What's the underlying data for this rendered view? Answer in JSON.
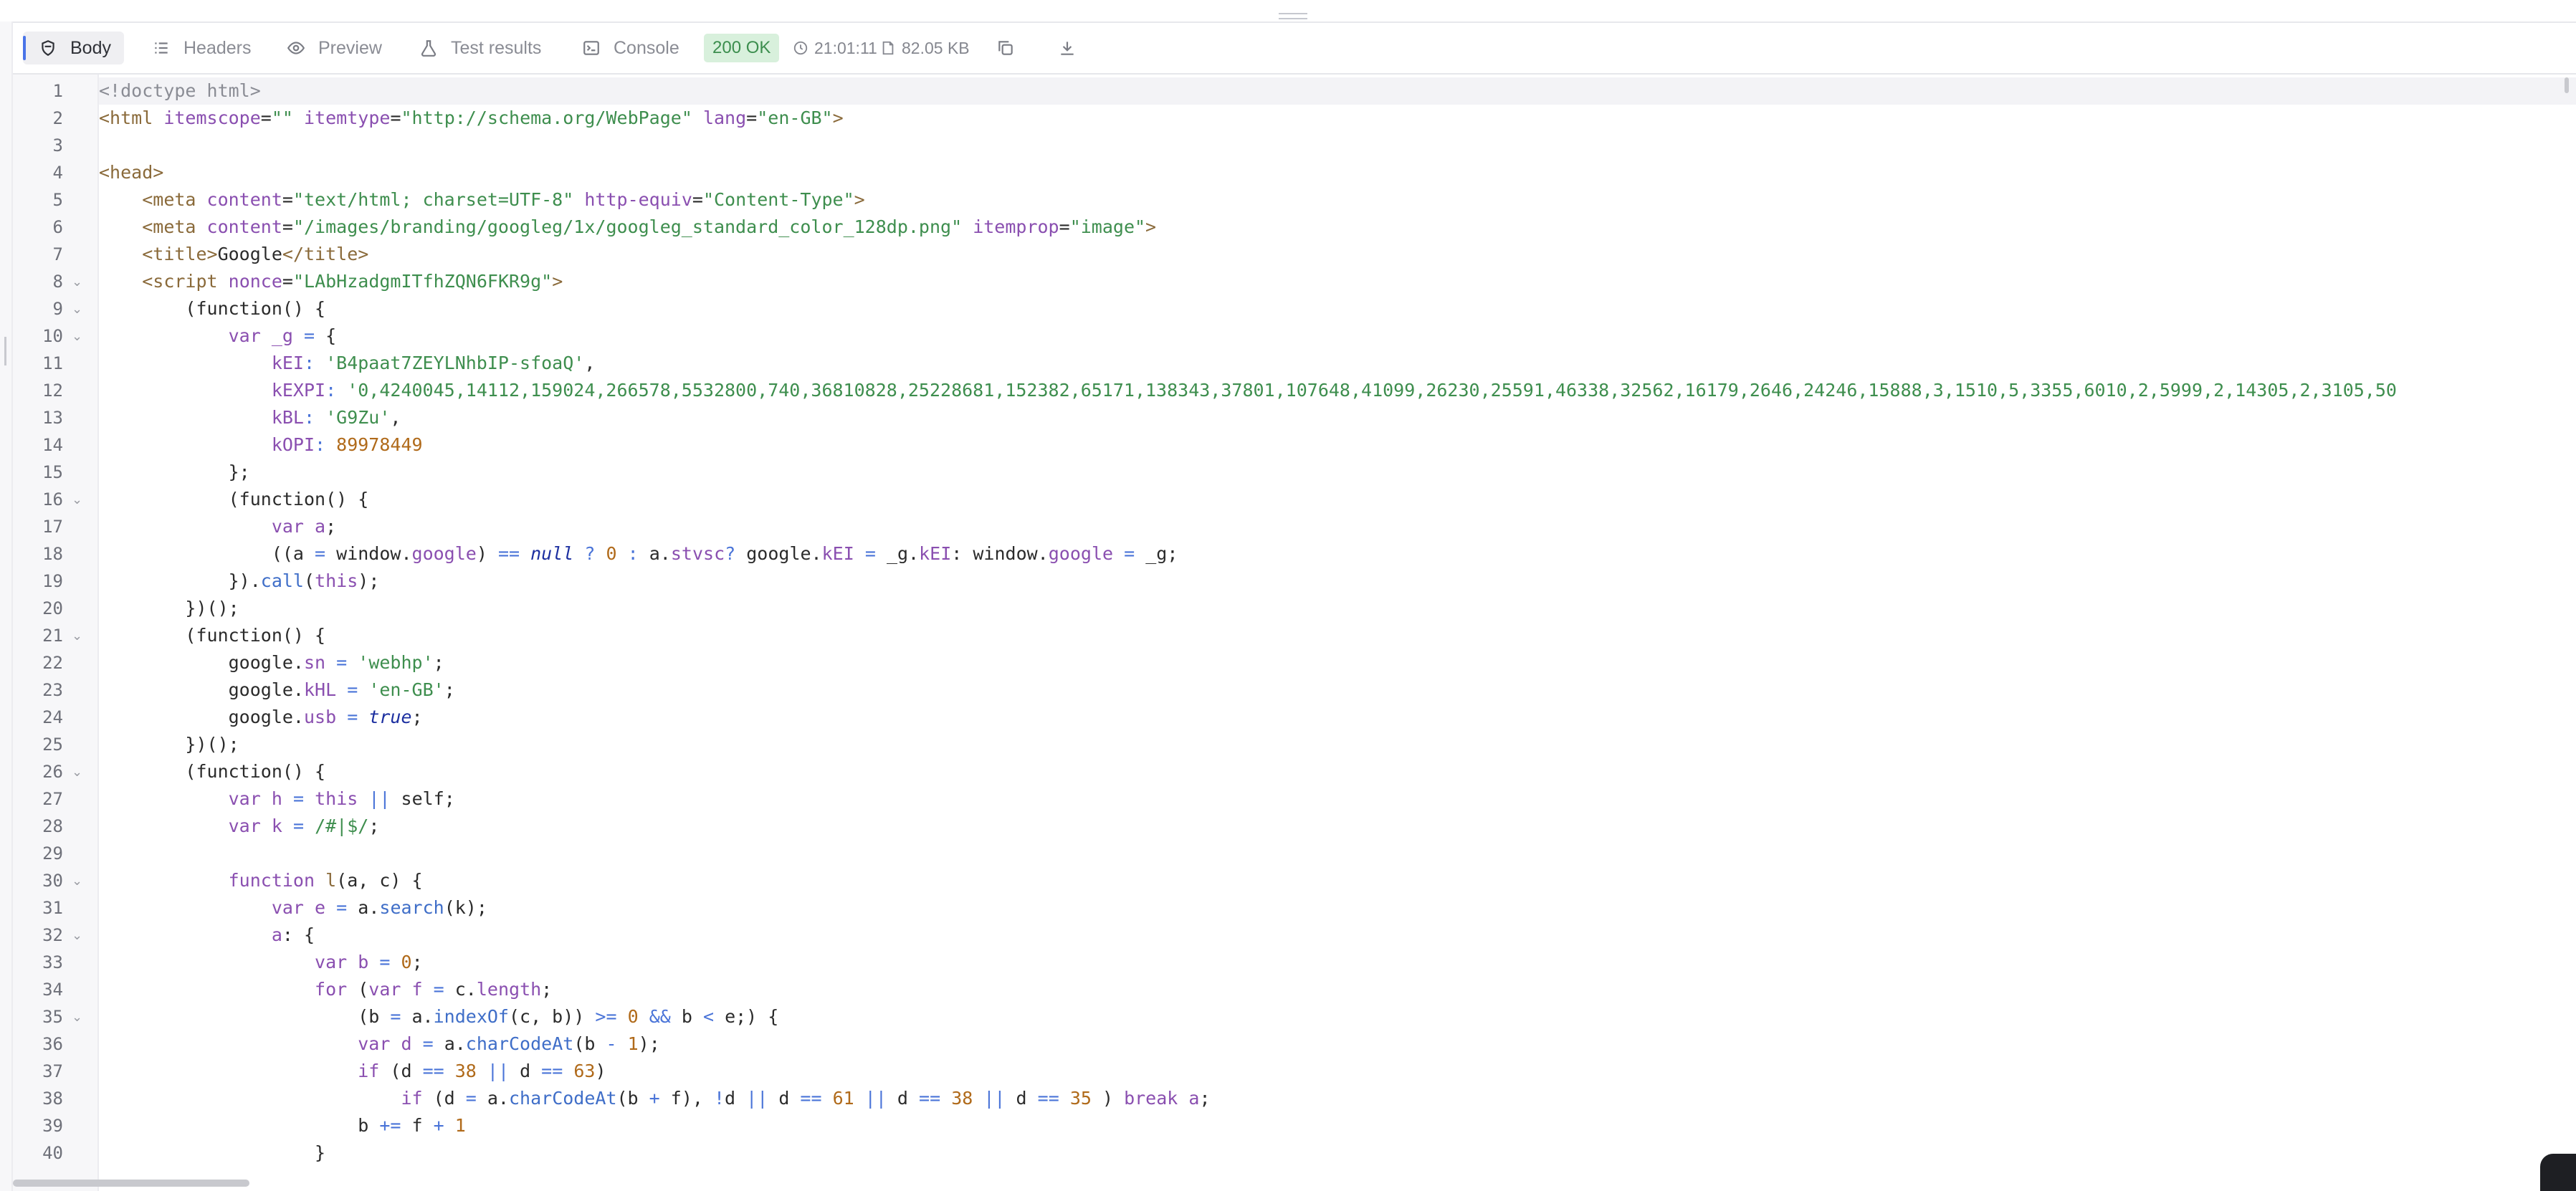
{
  "toolbar": {
    "tabs": [
      {
        "id": "body",
        "label": "Body",
        "icon": "shield-icon"
      },
      {
        "id": "headers",
        "label": "Headers",
        "icon": "list-icon"
      },
      {
        "id": "preview",
        "label": "Preview",
        "icon": "eye-icon"
      },
      {
        "id": "tests",
        "label": "Test results",
        "icon": "flask-icon"
      },
      {
        "id": "console",
        "label": "Console",
        "icon": "terminal-icon"
      }
    ],
    "status": "200 OK",
    "time": "21:01:11",
    "size": "82.05 KB",
    "copy_icon": "copy-icon",
    "download_icon": "download-icon"
  },
  "editor": {
    "current_line": 1,
    "fold_lines": [
      8,
      9,
      10,
      16,
      21,
      26,
      30,
      32,
      35
    ],
    "lines": [
      [
        [
          "c",
          "<!doctype html>"
        ]
      ],
      [
        [
          "t",
          "<html "
        ],
        [
          "a",
          "itemscope"
        ],
        [
          "",
          "="
        ],
        [
          "s",
          "\"\""
        ],
        [
          "",
          " "
        ],
        [
          "a",
          "itemtype"
        ],
        [
          "",
          "="
        ],
        [
          "s",
          "\"http://schema.org/WebPage\""
        ],
        [
          "",
          " "
        ],
        [
          "a",
          "lang"
        ],
        [
          "",
          "="
        ],
        [
          "s",
          "\"en-GB\""
        ],
        [
          "t",
          ">"
        ]
      ],
      [],
      [
        [
          "t",
          "<head>"
        ]
      ],
      [
        [
          "",
          "    "
        ],
        [
          "t",
          "<meta "
        ],
        [
          "a",
          "content"
        ],
        [
          "",
          "="
        ],
        [
          "s",
          "\"text/html; charset=UTF-8\""
        ],
        [
          "",
          " "
        ],
        [
          "a",
          "http-equiv"
        ],
        [
          "",
          "="
        ],
        [
          "s",
          "\"Content-Type\""
        ],
        [
          "t",
          ">"
        ]
      ],
      [
        [
          "",
          "    "
        ],
        [
          "t",
          "<meta "
        ],
        [
          "a",
          "content"
        ],
        [
          "",
          "="
        ],
        [
          "s",
          "\"/images/branding/googleg/1x/googleg_standard_color_128dp.png\""
        ],
        [
          "",
          " "
        ],
        [
          "a",
          "itemprop"
        ],
        [
          "",
          "="
        ],
        [
          "s",
          "\"image\""
        ],
        [
          "t",
          ">"
        ]
      ],
      [
        [
          "",
          "    "
        ],
        [
          "t",
          "<title>"
        ],
        [
          "",
          "Google"
        ],
        [
          "t",
          "</title>"
        ]
      ],
      [
        [
          "",
          "    "
        ],
        [
          "t",
          "<script "
        ],
        [
          "a",
          "nonce"
        ],
        [
          "",
          "="
        ],
        [
          "s",
          "\"LAbHzadgmITfhZQN6FKR9g\""
        ],
        [
          "t",
          ">"
        ]
      ],
      [
        [
          "",
          "        (function() {"
        ]
      ],
      [
        [
          "",
          "            "
        ],
        [
          "k",
          "var"
        ],
        [
          "",
          " "
        ],
        [
          "a",
          "_g"
        ],
        [
          "o",
          " = "
        ],
        [
          "",
          "{"
        ]
      ],
      [
        [
          "",
          "                "
        ],
        [
          "a",
          "kEI"
        ],
        [
          "o",
          ": "
        ],
        [
          "s",
          "'B4paat7ZEYLNhbIP-sfoaQ'"
        ],
        [
          "",
          ","
        ]
      ],
      [
        [
          "",
          "                "
        ],
        [
          "a",
          "kEXPI"
        ],
        [
          "o",
          ": "
        ],
        [
          "s",
          "'0,4240045,14112,159024,266578,5532800,740,36810828,25228681,152382,65171,138343,37801,107648,41099,26230,25591,46338,32562,16179,2646,24246,15888,3,1510,5,3355,6010,2,5999,2,14305,2,3105,50"
        ]
      ],
      [
        [
          "",
          "                "
        ],
        [
          "a",
          "kBL"
        ],
        [
          "o",
          ": "
        ],
        [
          "s",
          "'G9Zu'"
        ],
        [
          "",
          ","
        ]
      ],
      [
        [
          "",
          "                "
        ],
        [
          "a",
          "kOPI"
        ],
        [
          "o",
          ": "
        ],
        [
          "n",
          "89978449"
        ]
      ],
      [
        [
          "",
          "            };"
        ]
      ],
      [
        [
          "",
          "            (function() {"
        ]
      ],
      [
        [
          "",
          "                "
        ],
        [
          "k",
          "var"
        ],
        [
          "",
          " "
        ],
        [
          "a",
          "a"
        ],
        [
          "",
          ";"
        ]
      ],
      [
        [
          "",
          "                ((a "
        ],
        [
          "o",
          "="
        ],
        [
          "",
          " window."
        ],
        [
          "a",
          "google"
        ],
        [
          "",
          ") "
        ],
        [
          "o",
          "=="
        ],
        [
          "",
          " "
        ],
        [
          "i",
          "null"
        ],
        [
          "",
          " "
        ],
        [
          "o",
          "?"
        ],
        [
          "",
          " "
        ],
        [
          "n",
          "0"
        ],
        [
          "",
          " "
        ],
        [
          "o",
          ":"
        ],
        [
          "",
          " a."
        ],
        [
          "a",
          "stvsc"
        ],
        [
          ") ",
          ""
        ],
        [
          "o",
          "?"
        ],
        [
          "",
          " google."
        ],
        [
          "a",
          "kEI"
        ],
        [
          "",
          " "
        ],
        [
          "o",
          "="
        ],
        [
          "",
          " _g."
        ],
        [
          "a",
          "kEI"
        ],
        [
          "",
          ": window."
        ],
        [
          "a",
          "google"
        ],
        [
          "",
          " "
        ],
        [
          "o",
          "="
        ],
        [
          "",
          " _g;"
        ]
      ],
      [
        [
          "",
          "            })."
        ],
        [
          "f",
          "call"
        ],
        [
          "",
          "("
        ],
        [
          "k",
          "this"
        ],
        [
          "",
          ");"
        ]
      ],
      [
        [
          "",
          "        })();"
        ]
      ],
      [
        [
          "",
          "        (function() {"
        ]
      ],
      [
        [
          "",
          "            google."
        ],
        [
          "a",
          "sn"
        ],
        [
          "",
          " "
        ],
        [
          "o",
          "="
        ],
        [
          "",
          " "
        ],
        [
          "s",
          "'webhp'"
        ],
        [
          "",
          ";"
        ]
      ],
      [
        [
          "",
          "            google."
        ],
        [
          "a",
          "kHL"
        ],
        [
          "",
          " "
        ],
        [
          "o",
          "="
        ],
        [
          "",
          " "
        ],
        [
          "s",
          "'en-GB'"
        ],
        [
          "",
          ";"
        ]
      ],
      [
        [
          "",
          "            google."
        ],
        [
          "a",
          "usb"
        ],
        [
          "",
          " "
        ],
        [
          "o",
          "="
        ],
        [
          "",
          " "
        ],
        [
          "i",
          "true"
        ],
        [
          "",
          ";"
        ]
      ],
      [
        [
          "",
          "        })();"
        ]
      ],
      [
        [
          "",
          "        (function() {"
        ]
      ],
      [
        [
          "",
          "            "
        ],
        [
          "k",
          "var"
        ],
        [
          "",
          " "
        ],
        [
          "a",
          "h"
        ],
        [
          "",
          " "
        ],
        [
          "o",
          "="
        ],
        [
          "",
          " "
        ],
        [
          "k",
          "this"
        ],
        [
          "",
          " "
        ],
        [
          "o",
          "||"
        ],
        [
          "",
          " self;"
        ]
      ],
      [
        [
          "",
          "            "
        ],
        [
          "k",
          "var"
        ],
        [
          "",
          " "
        ],
        [
          "a",
          "k"
        ],
        [
          "",
          " "
        ],
        [
          "o",
          "="
        ],
        [
          "",
          " "
        ],
        [
          "s",
          "/#|$/"
        ],
        [
          "",
          ";"
        ]
      ],
      [],
      [
        [
          "",
          "            "
        ],
        [
          "k",
          "function"
        ],
        [
          "",
          " "
        ],
        [
          "t",
          "l"
        ],
        [
          "",
          "(a, c) {"
        ]
      ],
      [
        [
          "",
          "                "
        ],
        [
          "k",
          "var"
        ],
        [
          "",
          " "
        ],
        [
          "a",
          "e"
        ],
        [
          "",
          " "
        ],
        [
          "o",
          "="
        ],
        [
          "",
          " a."
        ],
        [
          "f",
          "search"
        ],
        [
          "",
          "(k);"
        ]
      ],
      [
        [
          "",
          "                "
        ],
        [
          "a",
          "a"
        ],
        [
          "",
          ": {"
        ]
      ],
      [
        [
          "",
          "                    "
        ],
        [
          "k",
          "var"
        ],
        [
          "",
          " "
        ],
        [
          "a",
          "b"
        ],
        [
          "",
          " "
        ],
        [
          "o",
          "="
        ],
        [
          "",
          " "
        ],
        [
          "n",
          "0"
        ],
        [
          "",
          ";"
        ]
      ],
      [
        [
          "",
          "                    "
        ],
        [
          "k",
          "for"
        ],
        [
          "",
          " ("
        ],
        [
          "k",
          "var"
        ],
        [
          "",
          " "
        ],
        [
          "a",
          "f"
        ],
        [
          "",
          " "
        ],
        [
          "o",
          "="
        ],
        [
          "",
          " c."
        ],
        [
          "a",
          "length"
        ],
        [
          "",
          ";"
        ]
      ],
      [
        [
          "",
          "                        (b "
        ],
        [
          "o",
          "="
        ],
        [
          "",
          " a."
        ],
        [
          "f",
          "indexOf"
        ],
        [
          "",
          "(c, b)) "
        ],
        [
          "o",
          ">="
        ],
        [
          "",
          " "
        ],
        [
          "n",
          "0"
        ],
        [
          "",
          " "
        ],
        [
          "o",
          "&&"
        ],
        [
          "",
          " b "
        ],
        [
          "o",
          "<"
        ],
        [
          "",
          " e;) {"
        ]
      ],
      [
        [
          "",
          "                        "
        ],
        [
          "k",
          "var"
        ],
        [
          "",
          " "
        ],
        [
          "a",
          "d"
        ],
        [
          "",
          " "
        ],
        [
          "o",
          "="
        ],
        [
          "",
          " a."
        ],
        [
          "f",
          "charCodeAt"
        ],
        [
          "",
          "(b "
        ],
        [
          "o",
          "-"
        ],
        [
          "",
          " "
        ],
        [
          "n",
          "1"
        ],
        [
          "",
          ");"
        ]
      ],
      [
        [
          "",
          "                        "
        ],
        [
          "k",
          "if"
        ],
        [
          "",
          " (d "
        ],
        [
          "o",
          "=="
        ],
        [
          "",
          " "
        ],
        [
          "n",
          "38"
        ],
        [
          "",
          " "
        ],
        [
          "o",
          "||"
        ],
        [
          "",
          " d "
        ],
        [
          "o",
          "=="
        ],
        [
          "",
          " "
        ],
        [
          "n",
          "63"
        ],
        [
          "",
          ")"
        ]
      ],
      [
        [
          "",
          "                            "
        ],
        [
          "k",
          "if"
        ],
        [
          "",
          " (d "
        ],
        [
          "o",
          "="
        ],
        [
          "",
          " a."
        ],
        [
          "f",
          "charCodeAt"
        ],
        [
          "",
          "(b "
        ],
        [
          "o",
          "+"
        ],
        [
          "",
          " f), "
        ],
        [
          "o",
          "!"
        ],
        [
          "",
          "d "
        ],
        [
          "o",
          "||"
        ],
        [
          "",
          " d "
        ],
        [
          "o",
          "=="
        ],
        [
          "",
          " "
        ],
        [
          "n",
          "61"
        ],
        [
          "",
          " "
        ],
        [
          "o",
          "||"
        ],
        [
          "",
          " d "
        ],
        [
          "o",
          "=="
        ],
        [
          "",
          " "
        ],
        [
          "n",
          "38"
        ],
        [
          "",
          " "
        ],
        [
          "o",
          "||"
        ],
        [
          "",
          " d "
        ],
        [
          "o",
          "=="
        ],
        [
          "",
          " "
        ],
        [
          "n",
          "35"
        ],
        [
          "",
          " ) "
        ],
        [
          "k",
          "break"
        ],
        [
          "",
          " "
        ],
        [
          "a",
          "a"
        ],
        [
          "",
          ";"
        ]
      ],
      [
        [
          "",
          "                        b "
        ],
        [
          "o",
          "+="
        ],
        [
          "",
          " f "
        ],
        [
          "o",
          "+"
        ],
        [
          "",
          " "
        ],
        [
          "n",
          "1"
        ]
      ],
      [
        [
          "",
          "                    }"
        ]
      ]
    ]
  }
}
